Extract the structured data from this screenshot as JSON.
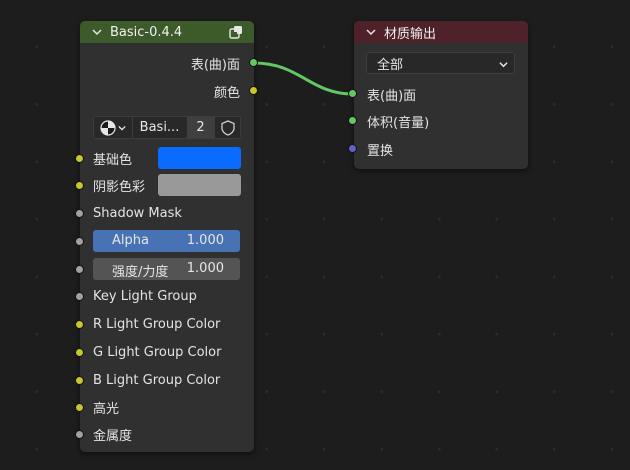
{
  "colors": {
    "header_basic": "#3d5a2a",
    "header_output": "#4f2129",
    "socket_shader": "#63c763",
    "socket_color": "#c7c729",
    "socket_float": "#a1a1a1",
    "socket_vector": "#6363c7",
    "base_color": "#0a6bff",
    "shadow_color": "#999999",
    "alpha_bar": "#4772b3",
    "link": "#63c763"
  },
  "basic_node": {
    "title": "Basic-0.4.4",
    "header_icon": "node-group-icon",
    "outputs": [
      {
        "label": "表(曲)面",
        "type": "shader"
      },
      {
        "label": "颜色",
        "type": "color"
      }
    ],
    "datablock": {
      "icon": "material-sphere-icon",
      "name": "Basi...",
      "users": "2",
      "fake_user_icon": "shield-icon"
    },
    "inputs": [
      {
        "label": "基础色",
        "type": "color"
      },
      {
        "label": "阴影色彩",
        "type": "color"
      },
      {
        "label": "Shadow Mask",
        "type": "float"
      },
      {
        "label": "Alpha",
        "value": "1.000",
        "fill": 1.0,
        "type": "float"
      },
      {
        "label": "强度/力度",
        "value": "1.000",
        "type": "float"
      },
      {
        "label": "Key Light Group",
        "type": "float"
      },
      {
        "label": "R Light Group Color",
        "type": "color"
      },
      {
        "label": "G Light Group Color",
        "type": "color"
      },
      {
        "label": "B Light Group Color",
        "type": "color"
      },
      {
        "label": "高光",
        "type": "color"
      },
      {
        "label": "金属度",
        "type": "float"
      }
    ]
  },
  "output_node": {
    "title": "材质输出",
    "target": "全部",
    "inputs": [
      {
        "label": "表(曲)面",
        "type": "shader"
      },
      {
        "label": "体积(音量)",
        "type": "shader"
      },
      {
        "label": "置换",
        "type": "vector"
      }
    ]
  }
}
